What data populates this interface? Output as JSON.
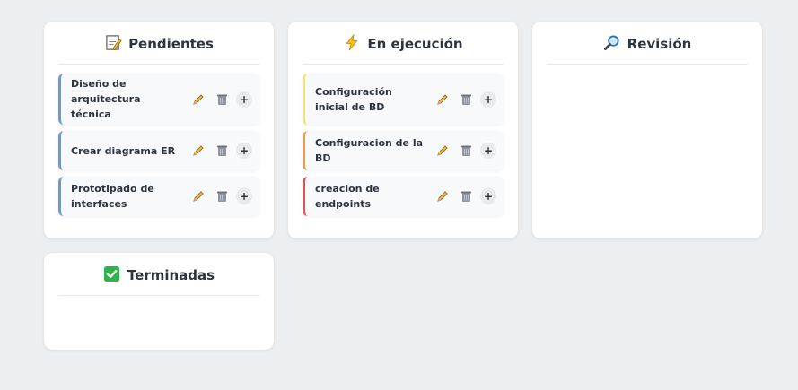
{
  "columns": [
    {
      "title": "Pendientes",
      "icon": "memo-icon",
      "cards": [
        {
          "text": "Diseño de arquitectura técnica",
          "color": "#6b9bc9"
        },
        {
          "text": "Crear diagrama ER",
          "color": "#6b9bc9"
        },
        {
          "text": "Prototipado de interfaces",
          "color": "#6b9bc9"
        }
      ]
    },
    {
      "title": "En ejecución",
      "icon": "lightning-icon",
      "cards": [
        {
          "text": "Configuración inicial de BD",
          "color": "#f4e06d"
        },
        {
          "text": "Configuracion de la BD",
          "color": "#f0984d"
        },
        {
          "text": "creacion de endpoints",
          "color": "#e8514f"
        }
      ]
    },
    {
      "title": "Revisión",
      "icon": "magnifier-icon",
      "cards": []
    },
    {
      "title": "Terminadas",
      "icon": "check-box-icon",
      "cards": []
    }
  ],
  "card_actions": {
    "add_label": "+"
  }
}
